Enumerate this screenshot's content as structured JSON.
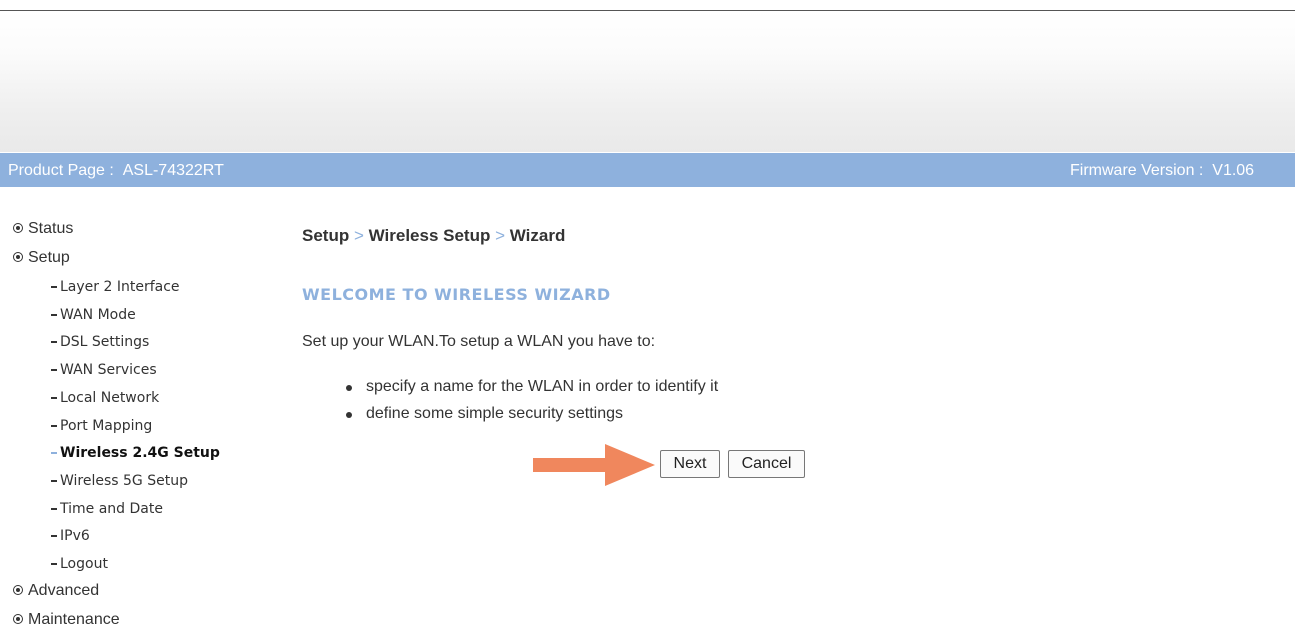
{
  "header": {
    "product_label": "Product Page :",
    "product_name": "ASL-74322RT",
    "firmware_label": "Firmware Version :",
    "firmware_version": "V1.06"
  },
  "sidebar": {
    "status": "Status",
    "setup": "Setup",
    "setup_items": [
      "Layer 2 Interface",
      "WAN Mode",
      "DSL Settings",
      "WAN Services",
      "Local Network",
      "Port Mapping",
      "Wireless 2.4G Setup",
      "Wireless 5G Setup",
      "Time and Date",
      "IPv6",
      "Logout"
    ],
    "active_item": "Wireless 2.4G Setup",
    "advanced": "Advanced",
    "maintenance": "Maintenance"
  },
  "main": {
    "breadcrumb": [
      "Setup",
      "Wireless Setup",
      "Wizard"
    ],
    "breadcrumb_separator": ">",
    "title": "WELCOME TO WIRELESS WIZARD",
    "intro": "Set up your WLAN.To setup a WLAN you have to:",
    "bullets": [
      "specify a name for the WLAN in order to identify it",
      "define some simple security settings"
    ],
    "next_button": "Next",
    "cancel_button": "Cancel"
  },
  "colors": {
    "accent": "#8eb1dd",
    "arrow": "#f0875d",
    "text": "#333333"
  }
}
